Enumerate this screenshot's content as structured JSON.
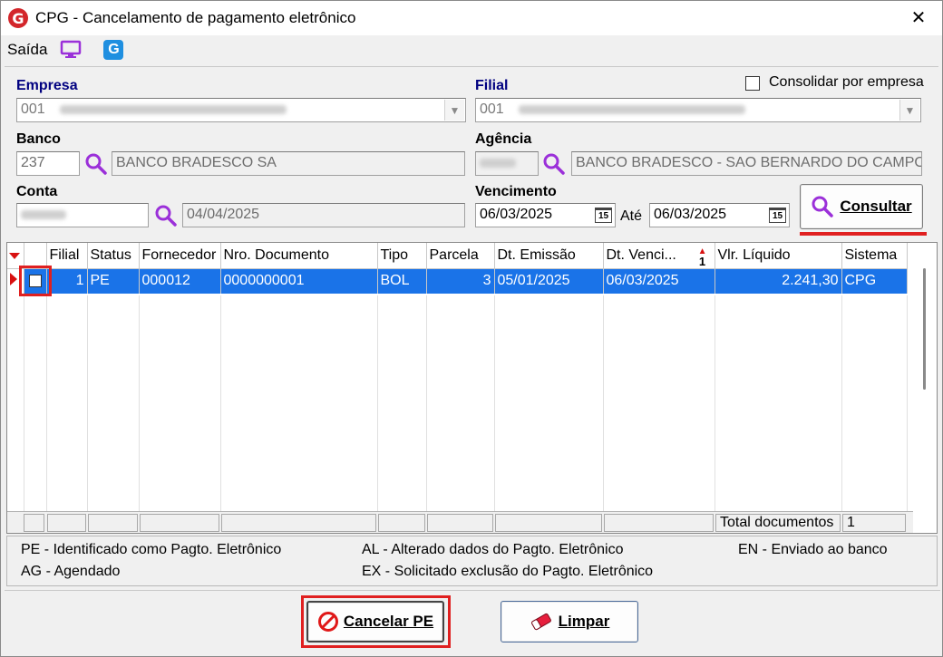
{
  "window": {
    "title": "CPG - Cancelamento de pagamento eletrônico",
    "logo_letter": "G",
    "close_glyph": "✕"
  },
  "toolbar": {
    "saida_label": "Saída",
    "g_letter": "G"
  },
  "filters": {
    "empresa_label": "Empresa",
    "empresa_value": "001",
    "filial_label": "Filial",
    "filial_value": "001",
    "consolidar_label": "Consolidar por empresa",
    "consolidar_checked": false,
    "banco_label": "Banco",
    "banco_code": "237",
    "banco_name": "BANCO BRADESCO SA",
    "agencia_label": "Agência",
    "agencia_name": "BANCO BRADESCO - SAO BERNARDO DO CAMPO",
    "conta_label": "Conta",
    "conta_date": "04/04/2025",
    "vencimento_label": "Vencimento",
    "venc_from": "06/03/2025",
    "ate_label": "Até",
    "venc_to": "06/03/2025",
    "calendar_glyph": "15",
    "consultar_label": "Consultar"
  },
  "grid": {
    "columns": [
      "Filial",
      "Status",
      "Fornecedor",
      "Nro. Documento",
      "Tipo",
      "Parcela",
      "Dt. Emissão",
      "Dt. Venci...",
      "Vlr. Líquido",
      "Sistema"
    ],
    "sort_indicator": "1",
    "rows": [
      {
        "checked": false,
        "filial": "1",
        "status": "PE",
        "fornecedor": "000012",
        "documento": "0000000001",
        "tipo": "BOL",
        "parcela": "3",
        "emissao": "05/01/2025",
        "vencimento": "06/03/2025",
        "valor": "2.241,30",
        "sistema": "CPG"
      }
    ],
    "total_label": "Total documentos",
    "total_value": "1"
  },
  "legend": {
    "pe": "PE - Identificado como Pagto. Eletrônico",
    "ag": "AG - Agendado",
    "al": "AL - Alterado dados do Pagto. Eletrônico",
    "ex": "EX - Solicitado exclusão do Pagto. Eletrônico",
    "en": "EN - Enviado ao banco"
  },
  "actions": {
    "cancelar_label": "Cancelar PE",
    "limpar_label": "Limpar"
  },
  "colors": {
    "selection": "#1a73e8",
    "label_blue": "#000080",
    "highlight_red": "#e02020",
    "icon_purple": "#9b30d9"
  }
}
